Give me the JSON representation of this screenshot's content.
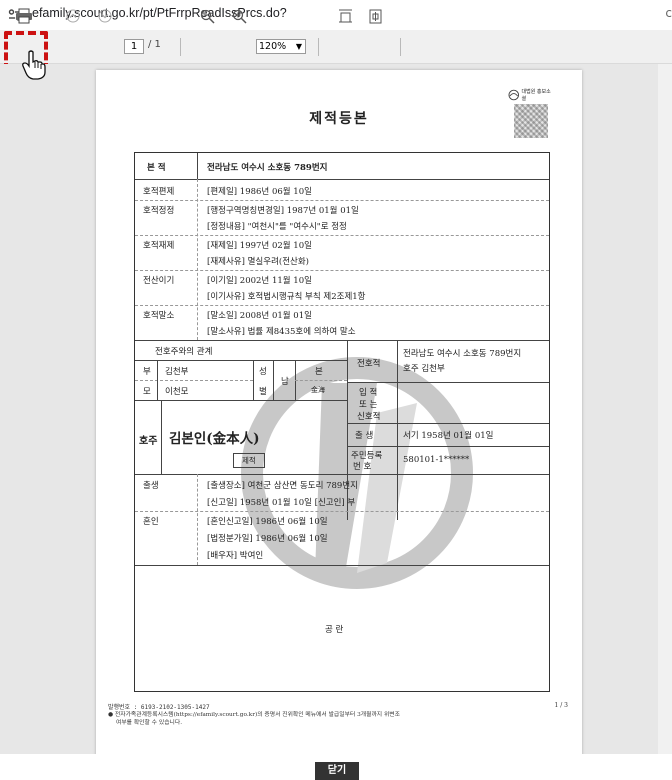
{
  "browser": {
    "url": "efamily.scourt.go.kr/pt/PtFrrpReadIssPrcs.do?",
    "url_trunc": "c"
  },
  "toolbar": {
    "page_current": "1",
    "page_total": "/ 1",
    "zoom": "120%",
    "zoom_options": [
      "120%"
    ],
    "highlight_color": "#cc1111"
  },
  "document": {
    "title": "제적등본",
    "seal_text": "대법원 홍보소셜",
    "header": {
      "label": "본 적",
      "value": "전라남도 여수시 소호동 789번지"
    },
    "events": [
      {
        "label": "호적편제",
        "lines": [
          "[편제일] 1986년 06월 10일"
        ]
      },
      {
        "label": "호적정정",
        "lines": [
          "[행정구역명칭변경일] 1987년 01월 01일",
          "[정정내용] \"여천시\"를 \"여수시\"로 정정"
        ]
      },
      {
        "label": "호적재제",
        "lines": [
          "[재제일] 1997년 02월 10일",
          "[재제사유] 멸실우려(전산화)"
        ]
      },
      {
        "label": "전산이기",
        "lines": [
          "[이기일] 2002년 11월 10일",
          "[이기사유] 호적법시행규칙 부칙 제2조제1항"
        ]
      },
      {
        "label": "호적말소",
        "lines": [
          "[말소일] 2008년 01월 01일",
          "[말소사유] 법률 제8435호에 의하여 말소"
        ]
      }
    ],
    "person": {
      "relation_header": "전호주와의 관계",
      "father_label": "부",
      "father_name": "김천부",
      "mother_label": "모",
      "mother_name": "이천모",
      "sex_label_1": "성",
      "sex_label_2": "별",
      "sex": "남",
      "origin_label": "본",
      "origin": "金海",
      "prev_head_label": "전호적",
      "prev_head_value_1": "전라남도 여수시 소호동 789번지",
      "prev_head_value_2": "호주 김천부",
      "entry_label_1": "입 적",
      "entry_label_2": "또 는",
      "entry_label_3": "신호적",
      "head_label": "호주",
      "name": "김본인(金本人)",
      "remove_stamp": "제적",
      "birth_label": "출 생",
      "birth_value": "서기 1958년 01월 01일",
      "rrn_label_1": "주민등록",
      "rrn_label_2": "번  호",
      "rrn_value": "580101-1******"
    },
    "personal_events": [
      {
        "label": "출생",
        "lines": [
          "[출생장소] 여천군 삼산면 동도리 789번지",
          "[신고일] 1958년 01월 10일        [신고인] 부"
        ]
      },
      {
        "label": "혼인",
        "lines": [
          "[혼인신고일] 1986년 06월 10일",
          "[법정분가일] 1986년 06월 10일",
          "[배우자] 박여인"
        ]
      }
    ],
    "blank_text": "공 란",
    "footer": {
      "issue_no": "발행번호 : 6193-2102-1305-1427",
      "page": "1  /  3",
      "note_1": "● 전자가족관계등록시스템(https://efamily.scourt.go.kr)의 증명서 진위확인 메뉴에서 발급일부터 3개월까지 위변조",
      "note_2": "여부를 확인할 수 있습니다."
    }
  },
  "close_button": "닫기"
}
